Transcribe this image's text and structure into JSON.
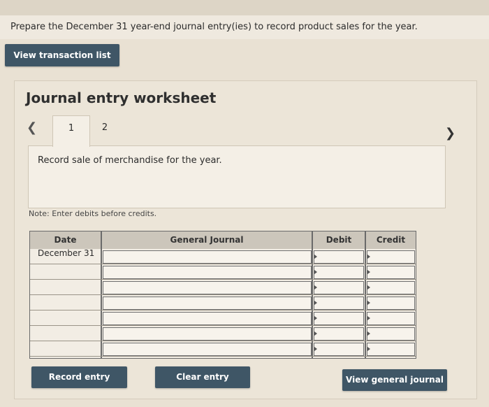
{
  "question": "Prepare the December 31 year-end journal entry(ies) to record product sales for the year.",
  "buttons": {
    "view_transaction_list": "View transaction list",
    "record_entry": "Record entry",
    "clear_entry": "Clear entry",
    "view_general_journal": "View general journal"
  },
  "worksheet": {
    "title": "Journal entry worksheet",
    "tabs": [
      "1",
      "2"
    ],
    "prev_icon": "chevron-left-icon",
    "next_icon": "chevron-right-icon",
    "description": "Record sale of merchandise for the year.",
    "note": "Note: Enter debits before credits."
  },
  "table": {
    "headers": {
      "date": "Date",
      "general_journal": "General Journal",
      "debit": "Debit",
      "credit": "Credit"
    },
    "rows": [
      {
        "date": "December 31",
        "account": "",
        "debit": "",
        "credit": ""
      },
      {
        "date": "",
        "account": "",
        "debit": "",
        "credit": ""
      },
      {
        "date": "",
        "account": "",
        "debit": "",
        "credit": ""
      },
      {
        "date": "",
        "account": "",
        "debit": "",
        "credit": ""
      },
      {
        "date": "",
        "account": "",
        "debit": "",
        "credit": ""
      },
      {
        "date": "",
        "account": "",
        "debit": "",
        "credit": ""
      },
      {
        "date": "",
        "account": "",
        "debit": "",
        "credit": ""
      }
    ]
  },
  "colors": {
    "button": "#3f5666",
    "background": "#e9e1d3",
    "header": "#ccc6bb"
  }
}
